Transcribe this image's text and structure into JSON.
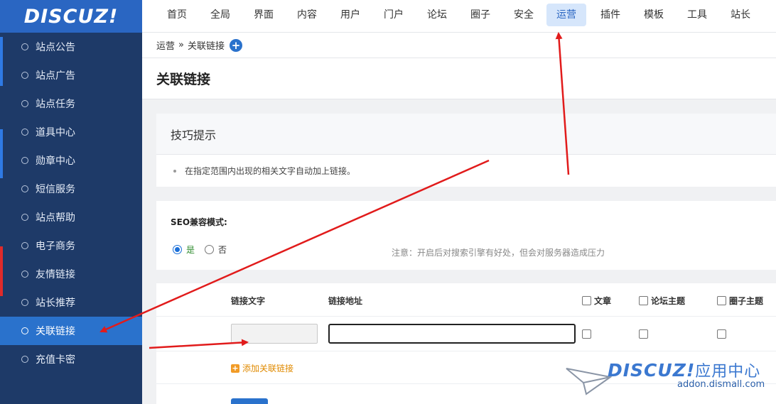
{
  "logo": "DISCUZ!",
  "sidebar": {
    "items": [
      {
        "label": "站点公告"
      },
      {
        "label": "站点广告"
      },
      {
        "label": "站点任务"
      },
      {
        "label": "道具中心"
      },
      {
        "label": "勋章中心"
      },
      {
        "label": "短信服务"
      },
      {
        "label": "站点帮助"
      },
      {
        "label": "电子商务"
      },
      {
        "label": "友情链接"
      },
      {
        "label": "站长推荐"
      },
      {
        "label": "关联链接",
        "active": true
      },
      {
        "label": "充值卡密"
      }
    ]
  },
  "nav": {
    "items": [
      {
        "label": "首页"
      },
      {
        "label": "全局"
      },
      {
        "label": "界面"
      },
      {
        "label": "内容"
      },
      {
        "label": "用户"
      },
      {
        "label": "门户"
      },
      {
        "label": "论坛"
      },
      {
        "label": "圈子"
      },
      {
        "label": "安全"
      },
      {
        "label": "运营",
        "active": true
      },
      {
        "label": "插件"
      },
      {
        "label": "模板"
      },
      {
        "label": "工具"
      },
      {
        "label": "站长"
      }
    ]
  },
  "breadcrumb": {
    "parent": "运营",
    "separator": "»",
    "current": "关联链接",
    "add_icon": "plus-circle-icon"
  },
  "page": {
    "title": "关联链接"
  },
  "tips": {
    "title": "技巧提示",
    "items": [
      "在指定范围内出现的相关文字自动加上链接。"
    ]
  },
  "seo": {
    "label": "SEO兼容模式:",
    "options": [
      {
        "label": "是",
        "selected": true
      },
      {
        "label": "否",
        "selected": false
      }
    ],
    "note": "注意：开启后对搜索引擎有好处，但会对服务器造成压力"
  },
  "links_table": {
    "headers": {
      "text": "链接文字",
      "url": "链接地址",
      "article": "文章",
      "forum_thread": "论坛主题",
      "group_thread": "圈子主题"
    },
    "rows": [
      {
        "text": "",
        "url": "",
        "article": false,
        "forum_thread": false,
        "group_thread": false
      }
    ],
    "add_label": "添加关联链接"
  },
  "watermark": {
    "brand": "DISCUZ!",
    "brand_cn": "应用中心",
    "domain": "addon.dismall.com"
  },
  "colors": {
    "sidebar_bg": "#1e3a68",
    "logo_bg": "#2a66c2",
    "active_item": "#2a72cc",
    "nav_active_bg": "#d6e6fb",
    "accent_orange": "#e08a00",
    "annotation_arrow": "#e11b1b"
  }
}
